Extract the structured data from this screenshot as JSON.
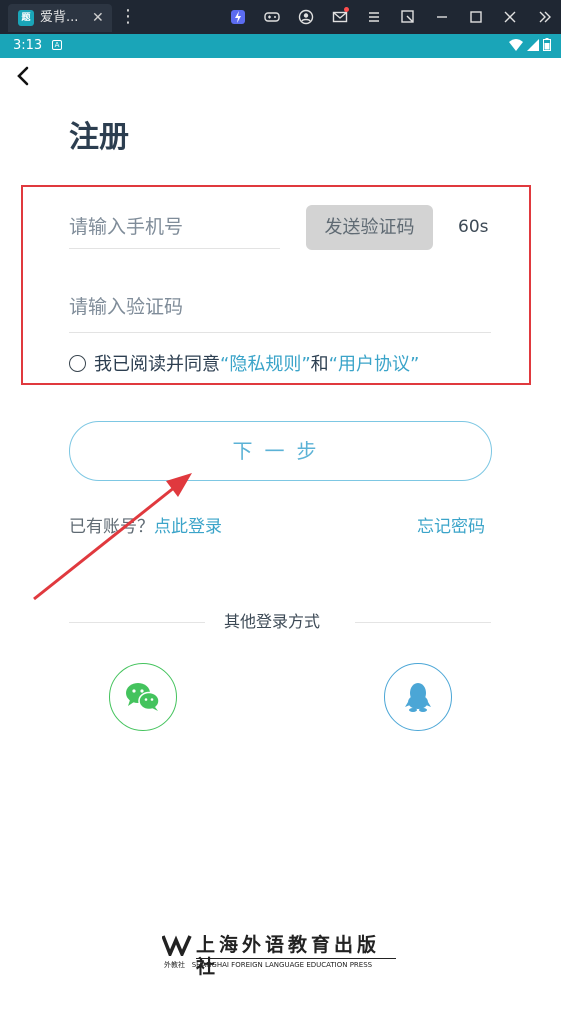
{
  "window": {
    "tab_title": "爱背...",
    "tab_close": "✕",
    "more": "⋮"
  },
  "status_bar": {
    "time": "3:13",
    "a_badge": "A"
  },
  "page": {
    "title": "注册",
    "phone_placeholder": "请输入手机号",
    "send_code_label": "发送验证码",
    "countdown": "60s",
    "code_placeholder": "请输入验证码",
    "agree_prefix": "我已阅读并同意",
    "privacy_link": "“隐私规则”",
    "and_text": "和",
    "user_agreement_link": "“用户协议”",
    "next_button": "下一步",
    "have_account": "已有账号？",
    "login_link": "点此登录",
    "forgot_password": "忘记密码",
    "other_login": "其他登录方式"
  },
  "social": [
    {
      "name": "wechat",
      "icon": "wechat-icon",
      "color": "#44c35d"
    },
    {
      "name": "qq",
      "icon": "qq-icon",
      "color": "#4ba6d6"
    }
  ],
  "footer": {
    "publisher_name": "上海外语教育出版社",
    "publisher_short": "外教社",
    "publisher_english": "SHANGHAI FOREIGN LANGUAGE EDUCATION PRESS"
  },
  "colors": {
    "status_bar": "#1aa5b8",
    "accent_blue": "#3ba4c9",
    "annotation_red": "#e0393e"
  }
}
